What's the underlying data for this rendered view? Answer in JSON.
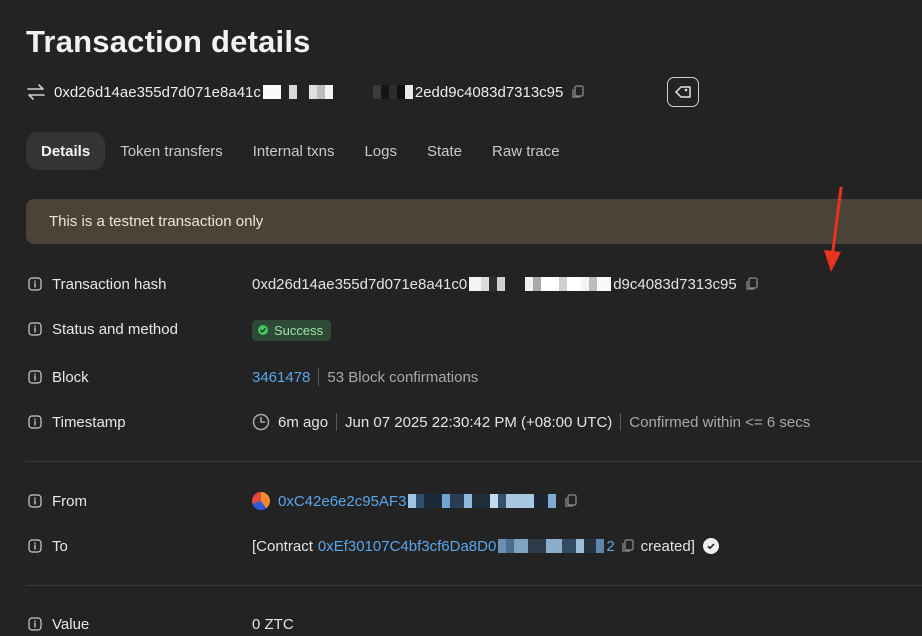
{
  "page_title": "Transaction details",
  "header": {
    "hash_prefix": "0xd26d14ae355d7d071e8a41c",
    "hash_suffix": "2edd9c4083d7313c95"
  },
  "tabs": [
    "Details",
    "Token transfers",
    "Internal txns",
    "Logs",
    "State",
    "Raw trace"
  ],
  "banner": "This is a testnet transaction only",
  "fields": {
    "tx_hash": {
      "label": "Transaction hash",
      "prefix": "0xd26d14ae355d7d071e8a41c0",
      "suffix": "d9c4083d7313c95"
    },
    "status": {
      "label": "Status and method",
      "value": "Success"
    },
    "block": {
      "label": "Block",
      "number": "3461478",
      "confirmations": "53 Block confirmations"
    },
    "timestamp": {
      "label": "Timestamp",
      "ago": "6m ago",
      "datetime": "Jun 07 2025 22:30:42 PM (+08:00 UTC)",
      "confirmed": "Confirmed within <= 6 secs"
    },
    "from": {
      "label": "From",
      "address_prefix": "0xC42e6e2c95AF3"
    },
    "to": {
      "label": "To",
      "open": "[Contract",
      "address_prefix": "0xEf30107C4bf3cf6Da8D0",
      "address_suffix": "2",
      "close": "created]"
    },
    "value": {
      "label": "Value",
      "amount": "0 ZTC"
    }
  },
  "colors": {
    "link": "#5aa6ea",
    "success": "#46c45f",
    "banner_bg": "#4a4438",
    "annotation": "#e8331f"
  }
}
